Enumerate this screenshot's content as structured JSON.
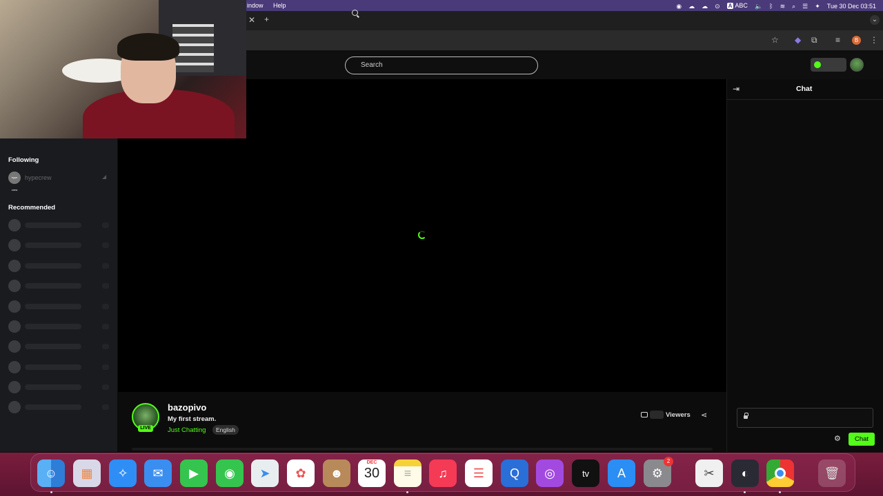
{
  "menubar": {
    "menus": [
      "indow",
      "Help"
    ],
    "ime_label": "ABC",
    "datetime": "Tue 30 Dec  03:51"
  },
  "site": {
    "search_placeholder": "Search"
  },
  "sidebar": {
    "following_heading": "Following",
    "following": [
      {
        "name": "hypecrew",
        "avatar_text": "hype crew"
      }
    ],
    "recommended_heading": "Recommended",
    "recommended_placeholder_count": 10
  },
  "stream": {
    "streamer": "bazopivo",
    "title": "My first stream.",
    "category": "Just Chatting",
    "language": "English",
    "live_label": "LIVE",
    "viewers_label": "Viewers"
  },
  "chat": {
    "title": "Chat",
    "send_label": "Chat"
  },
  "dock": {
    "calendar_month": "DEC",
    "calendar_day": "30",
    "settings_badge": "2",
    "apps": [
      "Finder",
      "Launchpad",
      "Safari",
      "Mail",
      "FaceTime",
      "Messages",
      "Maps",
      "Photos",
      "Contacts",
      "Calendar",
      "Notes",
      "Music",
      "Reminders",
      "QuickTime Player",
      "Podcasts",
      "TV",
      "App Store",
      "System Settings",
      "Preview",
      "OBS",
      "Chrome",
      "Trash"
    ]
  },
  "colors": {
    "accent": "#53fc18",
    "menubar": "#4a3a7a",
    "dock": "#7a1d3d"
  }
}
